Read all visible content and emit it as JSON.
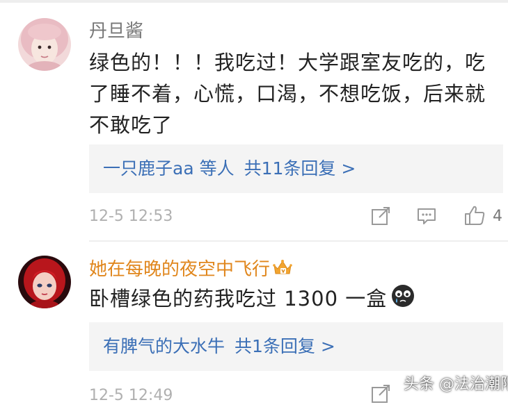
{
  "comments": [
    {
      "username": "丹旦酱",
      "text": "绿色的！！！我吃过！大学跟室友吃的，吃了睡不着，心慌，口渴，不想吃饭，后来就不敢吃了",
      "reply_users": "一只鹿子aa 等人",
      "reply_count": "共11条回复 >",
      "timestamp": "12-5 12:53",
      "like_count": "4",
      "username_color": "#777777"
    },
    {
      "username": "她在每晚的夜空中飞行",
      "text": "卧槽绿色的药我吃过 1300 一盒",
      "reply_users": "有脾气的大水牛",
      "reply_count": "共1条回复 >",
      "timestamp": "12-5 12:49",
      "username_color": "#e0861c"
    }
  ],
  "watermark": "头条 @法治潮阳",
  "icons": {
    "share": "share-icon",
    "comment": "comment-icon",
    "like": "thumbs-up-icon",
    "vip": "crown-icon",
    "emoji": "crying-emoji-icon"
  }
}
